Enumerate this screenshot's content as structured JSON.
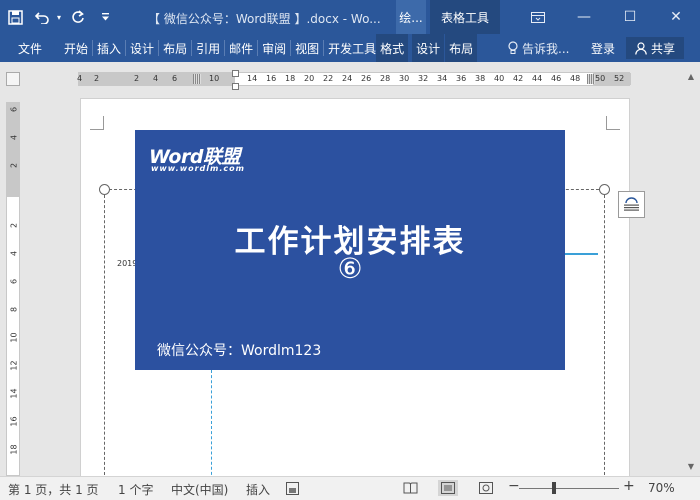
{
  "window": {
    "title": "【 微信公众号：Word联盟 】.docx - Wo...",
    "context_tab_draw": "绘...",
    "context_tab_table": "表格工具",
    "minimize": "—",
    "maximize": "☐",
    "restore": "◫",
    "close": "✕"
  },
  "qat": {
    "save_icon": "save-icon",
    "undo_icon": "undo-icon",
    "redo_icon": "redo-icon",
    "customize_icon": "customize-qat-icon"
  },
  "ribbon": {
    "tabs": [
      "文件",
      "开始",
      "插入",
      "设计",
      "布局",
      "引用",
      "邮件",
      "审阅",
      "视图",
      "开发工具",
      "格式",
      "设计",
      "布局"
    ],
    "tell_me": "告诉我...",
    "login": "登录",
    "share": "共享"
  },
  "ruler": {
    "h_ticks": [
      "4",
      "2",
      "2",
      "4",
      "6",
      "10",
      "14",
      "16",
      "18",
      "20",
      "22",
      "24",
      "26",
      "28",
      "30",
      "32",
      "34",
      "36",
      "38",
      "40",
      "42",
      "44",
      "46",
      "48",
      "50",
      "52"
    ],
    "v_ticks": [
      "6",
      "4",
      "2",
      "2",
      "4",
      "6",
      "8",
      "10",
      "12",
      "14",
      "16",
      "18"
    ]
  },
  "document": {
    "year_fragment": "2019",
    "banner": {
      "logo": "Word联盟",
      "logo_url": "www.wordlm.com",
      "title": "工作计划安排表",
      "number": "⑥",
      "wechat": "微信公众号：Wordlm123",
      "color": "#2c51a0"
    }
  },
  "statusbar": {
    "page": "第 1 页，共 1 页",
    "words": "1 个字",
    "language": "中文(中国)",
    "mode": "插入",
    "zoom": "70%",
    "zoom_minus": "−",
    "zoom_plus": "+"
  },
  "colors": {
    "ribbon": "#2b579a",
    "context": "#24497f"
  }
}
